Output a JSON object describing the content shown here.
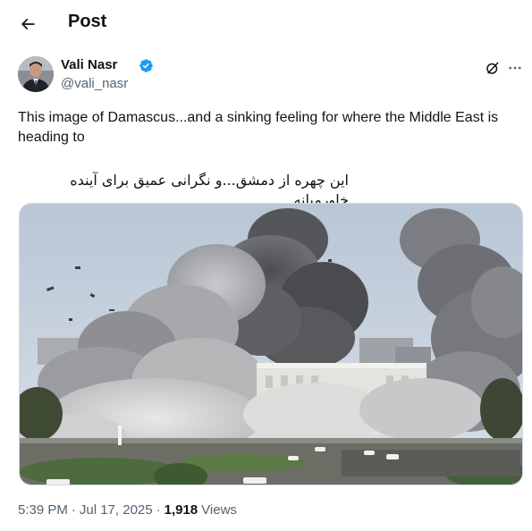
{
  "header": {
    "title": "Post"
  },
  "author": {
    "name": "Vali Nasr",
    "handle": "@vali_nasr",
    "verified": true
  },
  "tweet": {
    "text_en": "This image of Damascus...and a sinking feeling for where the Middle East is heading to",
    "text_fa": "این چهره از دمشق...و نگرانی عمیق برای آینده خاورمیانه"
  },
  "meta": {
    "time": "5:39 PM",
    "separator": "·",
    "date": "Jul 17, 2025",
    "views_count": "1,918",
    "views_label": "Views"
  },
  "colors": {
    "accent": "#1d9bf0",
    "text_primary": "#0f1419",
    "text_secondary": "#536471"
  },
  "icons": {
    "back": "arrow-left-icon",
    "verified": "verified-badge-icon",
    "grok": "grok-icon",
    "more": "more-horizontal-icon"
  }
}
